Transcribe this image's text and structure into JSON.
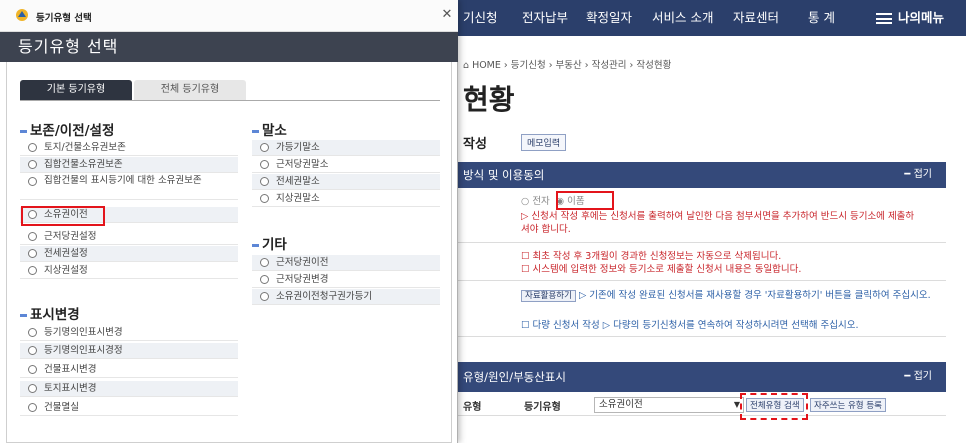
{
  "topnav": {
    "items": [
      "기신청",
      "전자납부",
      "확정일자",
      "서비스 소개",
      "자료센터",
      "통 계"
    ],
    "my_menu": "나의메뉴"
  },
  "page": {
    "breadcrumb": "HOME › 등기신청 › 부동산 › 작성관리 › 작성현황",
    "title": "현황",
    "section": "작성",
    "memo_button": "메모입력"
  },
  "panel1": {
    "title": "방식 및 이용동의",
    "fold": "접기",
    "method_options": [
      "전자",
      "이폼"
    ],
    "method_note": "신청서 작성 후에는 신청서를 출력하여 날인한 다음 첨부서면을 추가하여 반드시 등기소에 제출하셔야 합니다.",
    "agree1": "최초 작성 후 3개월이 경과한 신청정보는 자동으로 삭제됩니다.",
    "agree2": "시스템에 입력한 정보와 등기소로 제출할 신청서 내용은 동일합니다.",
    "reuse_button": "자료활용하기",
    "reuse_note": "기존에 작성 완료된 신청서를 재사용할 경우 '자료활용하기' 버튼을 클릭하여 주십시오.",
    "multi_note": "다량 신청서 작성 ▷ 다량의 등기신청서를 연속하여 작성하시려면 선택해 주십시오."
  },
  "panel2": {
    "title": "유형/원인/부동산표시",
    "fold": "접기",
    "row_label": "유형",
    "field_label": "등기유형",
    "select_value": "소유권이전",
    "search_button": "전체유형 검색",
    "fav_button": "자주쓰는 유형 등록"
  },
  "modal": {
    "window_title": "등기유형 선택",
    "header": "등기유형 선택",
    "tabs": [
      "기본 등기유형",
      "전체 등기유형"
    ],
    "groups": {
      "preserve": {
        "title": "보존/이전/설정",
        "items": [
          "토지/건물소유권보존",
          "집합건물소유권보존",
          "집합건물의 표시등기에 대한 소유권보존",
          "소유권이전",
          "근저당권설정",
          "전세권설정",
          "지상권설정"
        ]
      },
      "cancel": {
        "title": "말소",
        "items": [
          "가등기말소",
          "근저당권말소",
          "전세권말소",
          "지상권말소"
        ]
      },
      "etc": {
        "title": "기타",
        "items": [
          "근저당권이전",
          "근저당권변경",
          "소유권이전청구권가등기"
        ]
      },
      "display": {
        "title": "표시변경",
        "items": [
          "등기명의인표시변경",
          "등기명의인표시경정",
          "건물표시변경",
          "토지표시변경",
          "건물멸실"
        ]
      }
    }
  },
  "colors": {
    "nav": "#2b3f6b",
    "modal_header": "#3d4350",
    "highlight": "#e3141b",
    "accent_bar": "#5d87d6"
  }
}
